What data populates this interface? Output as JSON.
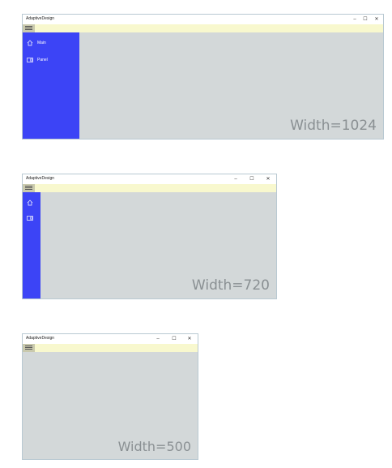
{
  "windows": [
    {
      "title": "AdaptiveDesign",
      "controls": {
        "minimize": "–",
        "maximize": "☐",
        "close": "✕"
      },
      "nav_items": [
        {
          "icon": "home-icon",
          "label": "Main"
        },
        {
          "icon": "panel-icon",
          "label": "Panel"
        }
      ],
      "sidebar_mode": "expanded",
      "width_label": "Width=1024"
    },
    {
      "title": "AdaptiveDesign",
      "controls": {
        "minimize": "–",
        "maximize": "☐",
        "close": "✕"
      },
      "nav_items": [
        {
          "icon": "home-icon",
          "label": ""
        },
        {
          "icon": "panel-icon",
          "label": ""
        }
      ],
      "sidebar_mode": "compact",
      "width_label": "Width=720"
    },
    {
      "title": "AdaptiveDesign",
      "controls": {
        "minimize": "–",
        "maximize": "☐",
        "close": "✕"
      },
      "nav_items": [],
      "sidebar_mode": "hidden",
      "width_label": "Width=500"
    }
  ],
  "colors": {
    "sidebar": "#3c44f6",
    "toolbar": "#f8f8ce",
    "content": "#d3d8d9",
    "hamburger": "#c9c9ad",
    "width_text": "#8a9093"
  }
}
